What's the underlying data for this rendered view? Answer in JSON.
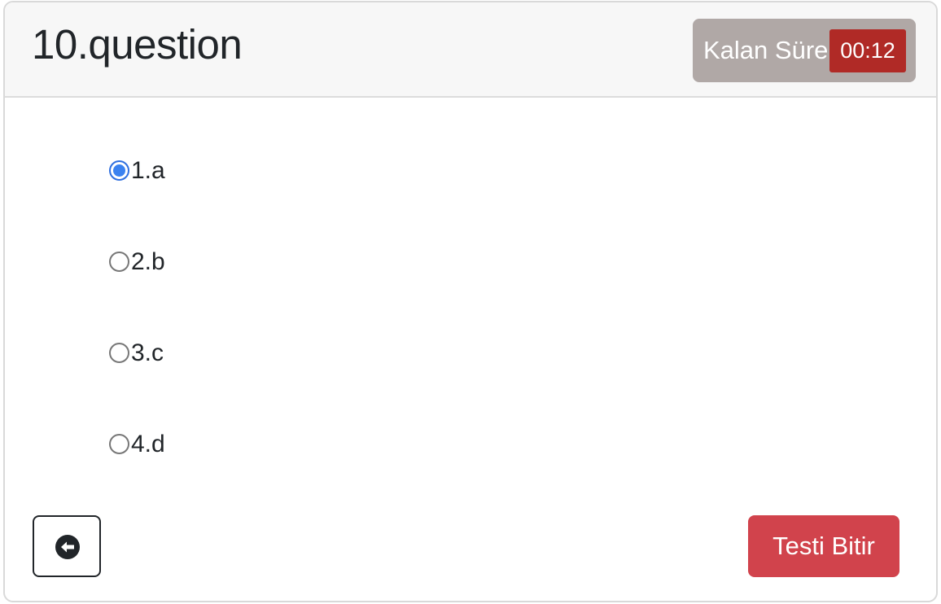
{
  "question": {
    "title": "10.question"
  },
  "timer": {
    "label": "Kalan Süre",
    "value": "00:12"
  },
  "options": [
    {
      "label": "1.a",
      "selected": true
    },
    {
      "label": "2.b",
      "selected": false
    },
    {
      "label": "3.c",
      "selected": false
    },
    {
      "label": "4.d",
      "selected": false
    }
  ],
  "footer": {
    "back_icon": "arrow-left-circle-icon",
    "finish_label": "Testi Bitir"
  },
  "colors": {
    "timer_box": "#b0a8a6",
    "timer_value_bg": "#b02a26",
    "finish_button": "#d1434c",
    "radio_selected": "#3b82f0"
  }
}
